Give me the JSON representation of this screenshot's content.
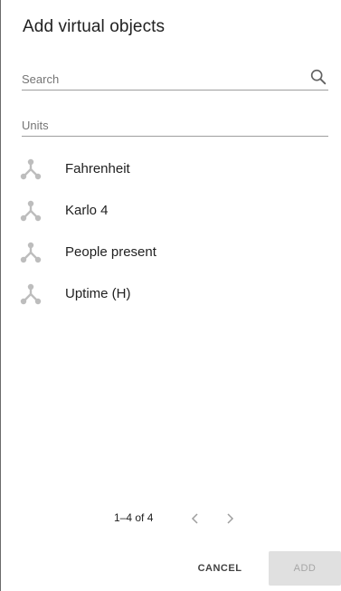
{
  "dialog": {
    "title": "Add virtual objects"
  },
  "search": {
    "placeholder": "Search",
    "value": ""
  },
  "units": {
    "placeholder": "Units",
    "value": ""
  },
  "items": [
    {
      "label": "Fahrenheit",
      "icon": "virtual-object-icon"
    },
    {
      "label": "Karlo 4",
      "icon": "virtual-object-icon"
    },
    {
      "label": "People present",
      "icon": "virtual-object-icon"
    },
    {
      "label": "Uptime (H)",
      "icon": "virtual-object-icon"
    }
  ],
  "pagination": {
    "range_label": "1–4 of 4"
  },
  "actions": {
    "cancel_label": "CANCEL",
    "add_label": "ADD"
  },
  "colors": {
    "text": "#212121",
    "icon": "#bdbdbd",
    "divider": "#9e9e9e",
    "disabled_button_bg": "#e0e0e0",
    "disabled_button_text": "#a6a6a6"
  }
}
